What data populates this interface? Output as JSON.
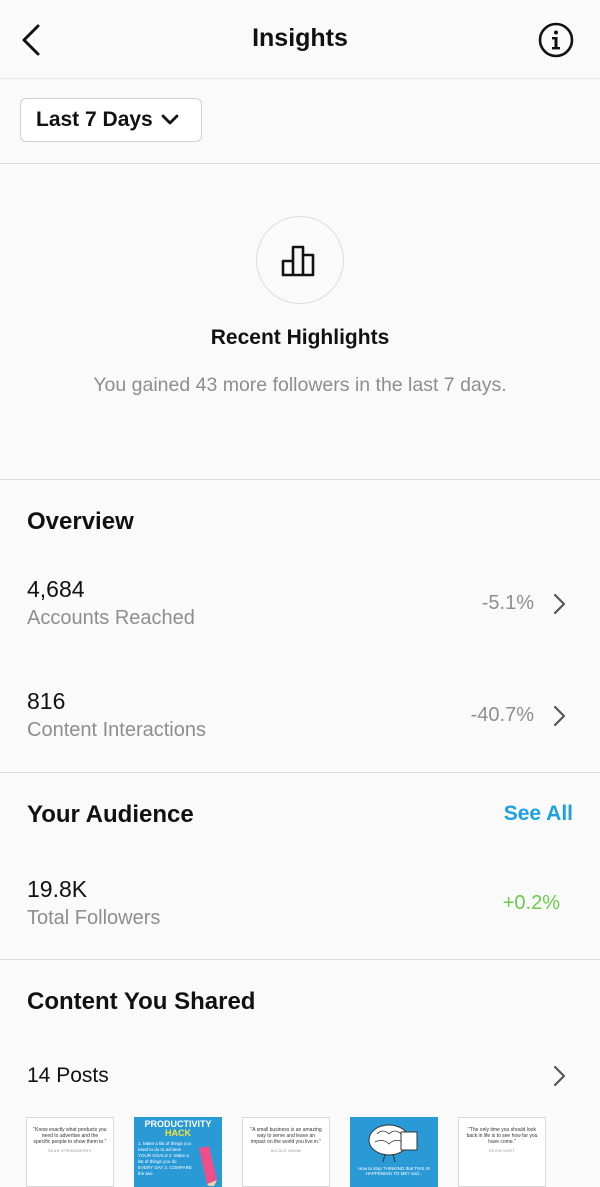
{
  "header": {
    "title": "Insights"
  },
  "filter": {
    "label": "Last 7 Days"
  },
  "highlights": {
    "title": "Recent Highlights",
    "text": "You gained 43 more followers in the last 7 days."
  },
  "overview": {
    "title": "Overview",
    "metrics": [
      {
        "value": "4,684",
        "label": "Accounts Reached",
        "delta": "-5.1%"
      },
      {
        "value": "816",
        "label": "Content Interactions",
        "delta": "-40.7%"
      }
    ]
  },
  "audience": {
    "title": "Your Audience",
    "see_all": "See All",
    "value": "19.8K",
    "label": "Total Followers",
    "delta": "+0.2%"
  },
  "content": {
    "title": "Content You Shared",
    "posts_label": "14 Posts",
    "thumbnails": [
      {
        "quote": "\"Know exactly what products you need to advertise and the specific people to show them to.\"",
        "author": "SEAN STRINGBERRY"
      },
      {
        "title_line1": "PRODUCTIVITY",
        "title_line2": "HACK",
        "body": "1. Make a list of things you need to do to achieve YOUR GOALS 2. Make a list of things you do EVERY DAY 3. COMPARE the two"
      },
      {
        "quote": "\"A small business is an amazing way to serve and leave an impact on the world you live in.\"",
        "author": "NICOLE SNOW"
      },
      {
        "caption": "How to stop THINKING that THIS IS HAPPENING TO ME? and..."
      },
      {
        "quote": "\"The only time you should look back in life is to see how far you have come.\"",
        "author": "KEVIN HART"
      }
    ]
  },
  "colors": {
    "accent": "#1da1e0",
    "positive": "#6cc94c",
    "muted": "#8e8e8e"
  }
}
